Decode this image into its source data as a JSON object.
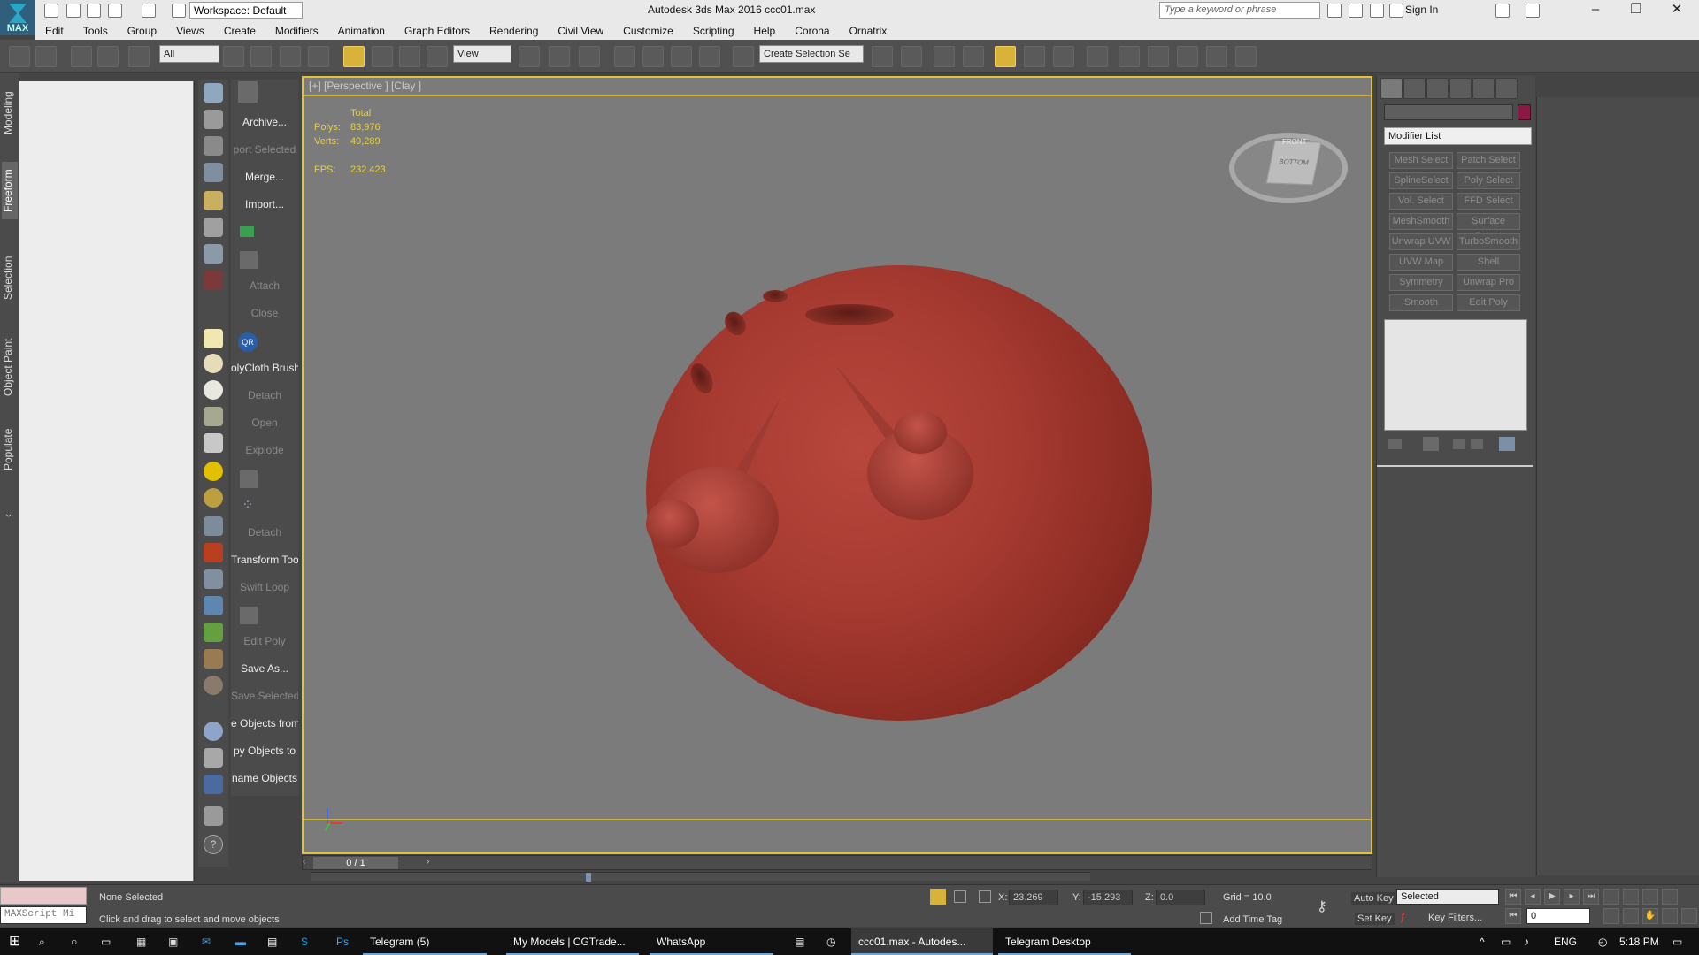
{
  "window": {
    "workspace": "Workspace: Default",
    "title": "Autodesk 3ds Max 2016    ccc01.max",
    "search_placeholder": "Type a keyword or phrase",
    "signin": "Sign In",
    "logo": "MAX"
  },
  "menus": [
    "Edit",
    "Tools",
    "Group",
    "Views",
    "Create",
    "Modifiers",
    "Animation",
    "Graph Editors",
    "Rendering",
    "Civil View",
    "Customize",
    "Scripting",
    "Help",
    "Corona",
    "Ornatrix"
  ],
  "toolbar": {
    "selection_filter": "All",
    "coord_system": "View",
    "selection_set": "Create Selection Se"
  },
  "ribbon_tabs": [
    "Modeling",
    "Freeform",
    "Selection",
    "Object Paint",
    "Populate"
  ],
  "commands": [
    {
      "label": "Archive...",
      "dim": false
    },
    {
      "label": "port Selected",
      "dim": true
    },
    {
      "label": "Merge...",
      "dim": false
    },
    {
      "label": "Import...",
      "dim": false
    },
    {
      "label": "Attach",
      "dim": true
    },
    {
      "label": "Close",
      "dim": true
    },
    {
      "label": "olyCloth Brush",
      "dim": false
    },
    {
      "label": "Detach",
      "dim": true
    },
    {
      "label": "Open",
      "dim": true
    },
    {
      "label": "Explode",
      "dim": true
    },
    {
      "label": "Detach",
      "dim": true
    },
    {
      "label": "Transform Tool",
      "dim": false
    },
    {
      "label": "Swift Loop",
      "dim": true
    },
    {
      "label": "Edit Poly",
      "dim": true
    },
    {
      "label": "Save As...",
      "dim": false
    },
    {
      "label": "Save Selected",
      "dim": true
    },
    {
      "label": "e Objects from",
      "dim": false
    },
    {
      "label": "py Objects to",
      "dim": false
    },
    {
      "label": "name Objects",
      "dim": false
    }
  ],
  "viewport": {
    "label": "[+] [Perspective ] [Clay ]",
    "stats_header": "Total",
    "polys_label": "Polys:",
    "polys": "83,976",
    "verts_label": "Verts:",
    "verts": "49,289",
    "fps_label": "FPS:",
    "fps": "232.423",
    "viewcube_front": "FRONT",
    "viewcube_bottom": "BOTTOM"
  },
  "time_slider": {
    "frame": "0 / 1"
  },
  "command_panel": {
    "modifier_list": "Modifier List",
    "object_color": "#8a1a44",
    "modifiers": [
      [
        "Mesh Select",
        "Patch Select"
      ],
      [
        "SplineSelect",
        "Poly Select"
      ],
      [
        "Vol. Select",
        "FFD Select"
      ],
      [
        "MeshSmooth",
        "Surface Select"
      ],
      [
        "Unwrap UVW",
        "TurboSmooth"
      ],
      [
        "UVW Map",
        "Shell"
      ],
      [
        "Symmetry",
        "Unwrap Pro"
      ],
      [
        "Smooth",
        "Edit Poly"
      ]
    ]
  },
  "status": {
    "selection": "None Selected",
    "prompt": "Click and drag to select and move objects",
    "maxscript": "MAXScript Mi",
    "x_label": "X:",
    "x": "23.269",
    "y_label": "Y:",
    "y": "-15.293",
    "z_label": "Z:",
    "z": "0.0",
    "grid": "Grid = 10.0",
    "add_time_tag": "Add Time Tag",
    "auto_key": "Auto Key",
    "set_key": "Set Key",
    "key_mode": "Selected",
    "key_filters": "Key Filters...",
    "frame_field": "0"
  },
  "taskbar": {
    "items": [
      "Telegram (5)",
      "My Models | CGTrade...",
      "WhatsApp",
      "ccc01.max - Autodes...",
      "Telegram Desktop"
    ],
    "lang": "ENG",
    "time": "5:18 PM"
  },
  "colors": {
    "viewport_border": "#e0c438",
    "object": "#a63a31",
    "accent_button": "#d9b23a"
  }
}
